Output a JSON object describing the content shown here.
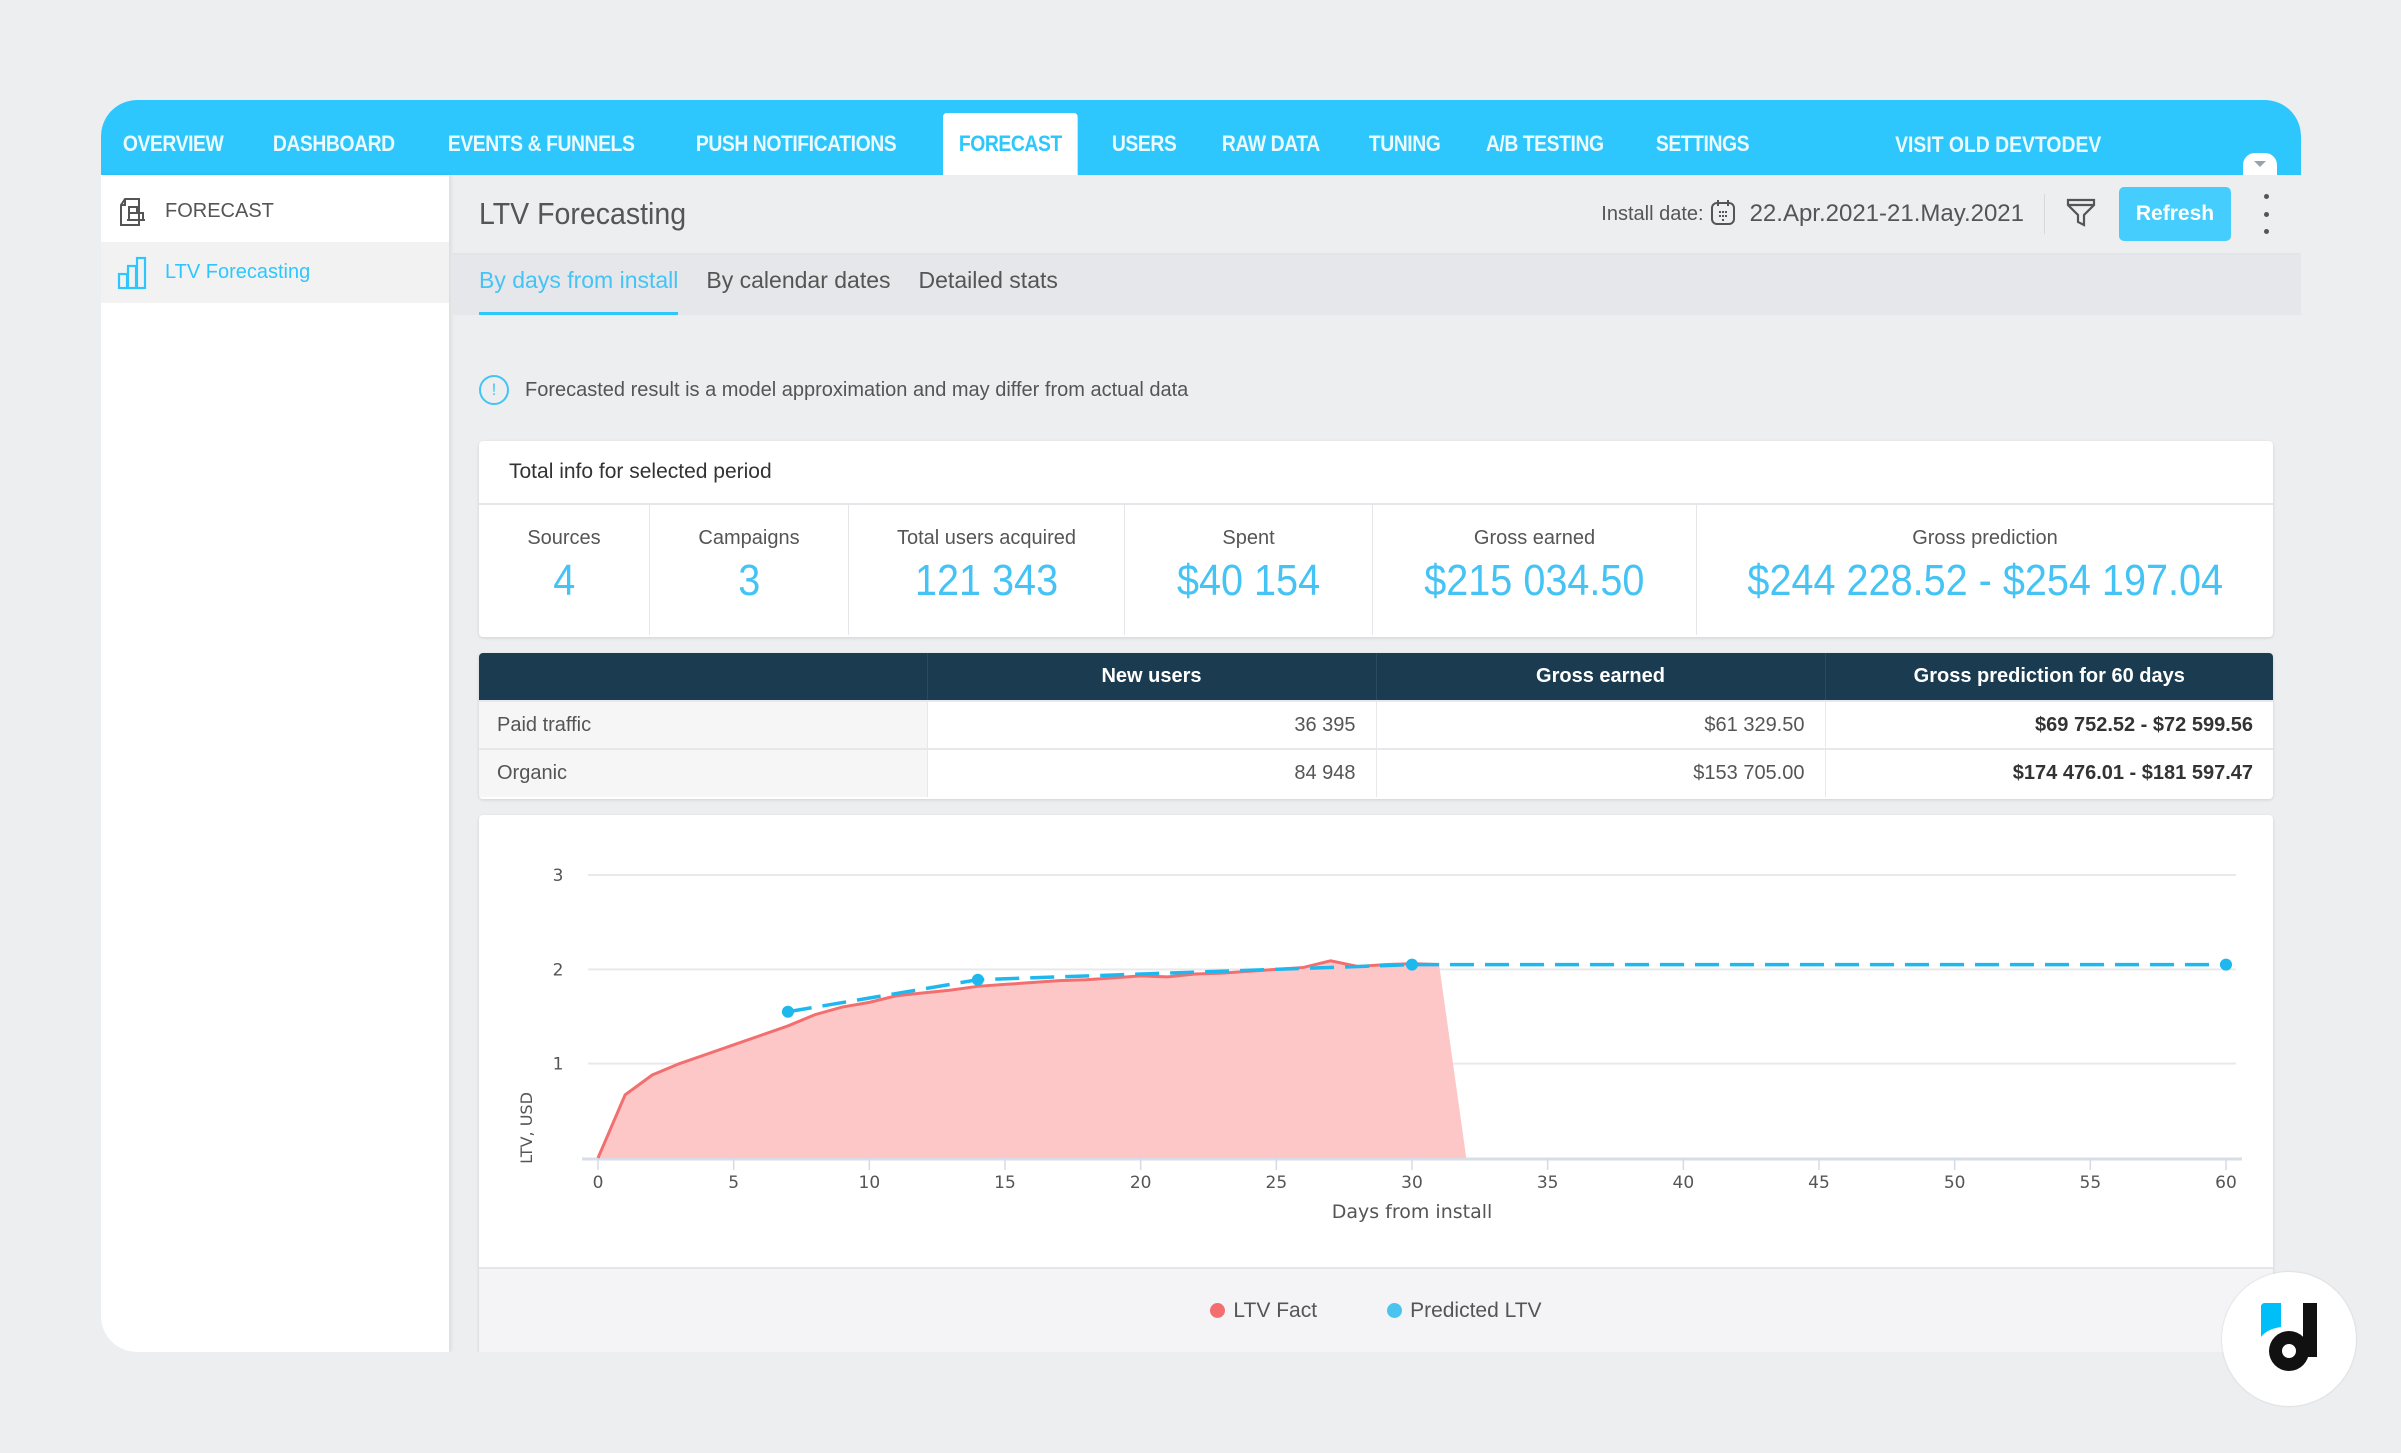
{
  "nav": {
    "items": [
      {
        "label": "OVERVIEW"
      },
      {
        "label": "DASHBOARD"
      },
      {
        "label": "EVENTS & FUNNELS"
      },
      {
        "label": "PUSH NOTIFICATIONS"
      },
      {
        "label": "FORECAST",
        "active": true
      },
      {
        "label": "USERS"
      },
      {
        "label": "RAW DATA"
      },
      {
        "label": "TUNING"
      },
      {
        "label": "A/B TESTING"
      },
      {
        "label": "SETTINGS"
      }
    ],
    "right_link": "VISIT OLD DEVTODEV"
  },
  "sidebar": {
    "section_label": "FORECAST",
    "items": [
      {
        "label": "LTV Forecasting",
        "active": true
      }
    ]
  },
  "header": {
    "title": "LTV Forecasting",
    "install_date_label": "Install date:",
    "install_date_value": "22.Apr.2021-21.May.2021",
    "refresh_label": "Refresh"
  },
  "tabs": [
    {
      "label": "By days from install",
      "active": true
    },
    {
      "label": "By calendar dates"
    },
    {
      "label": "Detailed stats"
    }
  ],
  "notice": "Forecasted result is a model approximation and may differ from actual data",
  "totals": {
    "title": "Total info for selected period",
    "stats": [
      {
        "label": "Sources",
        "value": "4"
      },
      {
        "label": "Campaigns",
        "value": "3"
      },
      {
        "label": "Total users acquired",
        "value": "121 343"
      },
      {
        "label": "Spent",
        "value": "$40 154"
      },
      {
        "label": "Gross earned",
        "value": "$215 034.50"
      },
      {
        "label": "Gross prediction",
        "value": "$244 228.52 - $254 197.04"
      }
    ]
  },
  "table": {
    "headers": [
      "",
      "New users",
      "Gross earned",
      "Gross prediction for 60 days"
    ],
    "rows": [
      [
        "Paid traffic",
        "36 395",
        "$61 329.50",
        "$69 752.52 - $72 599.56"
      ],
      [
        "Organic",
        "84 948",
        "$153 705.00",
        "$174 476.01 - $181 597.47"
      ]
    ]
  },
  "colors": {
    "accent": "#2dc7fd",
    "ltv_fact": "#f36f6f",
    "ltv_fact_fill": "#fdc4c4",
    "predicted": "#1fb8ee",
    "table_header": "#1b3c50"
  },
  "chart_data": {
    "type": "area",
    "title": "",
    "xlabel": "Days from install",
    "ylabel": "LTV, USD",
    "xlim": [
      0,
      60
    ],
    "ylim": [
      0,
      3
    ],
    "x_ticks": [
      0,
      5,
      10,
      15,
      20,
      25,
      30,
      35,
      40,
      45,
      50,
      55,
      60
    ],
    "y_ticks": [
      1,
      2,
      3
    ],
    "grid": true,
    "legend_position": "bottom",
    "series": [
      {
        "name": "LTV Fact",
        "type": "area",
        "x": [
          0,
          1,
          2,
          3,
          4,
          5,
          6,
          7,
          8,
          9,
          10,
          11,
          12,
          13,
          14,
          15,
          16,
          17,
          18,
          19,
          20,
          21,
          22,
          23,
          24,
          25,
          26,
          27,
          28,
          29,
          30,
          31,
          32
        ],
        "values": [
          0,
          0.67,
          0.88,
          1.0,
          1.1,
          1.2,
          1.3,
          1.4,
          1.52,
          1.6,
          1.65,
          1.72,
          1.75,
          1.78,
          1.82,
          1.84,
          1.86,
          1.88,
          1.89,
          1.91,
          1.93,
          1.92,
          1.95,
          1.96,
          1.98,
          2.0,
          2.02,
          2.09,
          2.03,
          2.05,
          2.06,
          2.05,
          0
        ]
      },
      {
        "name": "Predicted LTV",
        "type": "line-dashed",
        "x": [
          7,
          14,
          30,
          60
        ],
        "values": [
          1.55,
          1.89,
          2.05,
          2.05
        ]
      }
    ]
  }
}
